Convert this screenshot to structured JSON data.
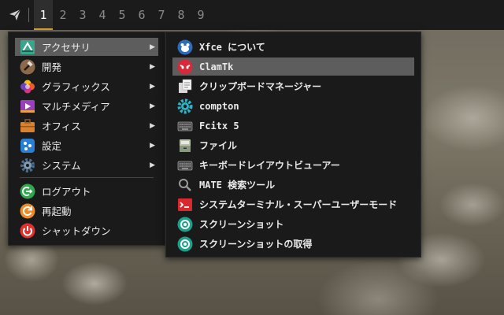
{
  "panel": {
    "workspaces": [
      "1",
      "2",
      "3",
      "4",
      "5",
      "6",
      "7",
      "8",
      "9"
    ],
    "active_workspace": "1"
  },
  "main_menu": {
    "items": [
      {
        "label": "アクセサリ",
        "icon": "accessories-icon"
      },
      {
        "label": "開発",
        "icon": "hammer-icon"
      },
      {
        "label": "グラフィックス",
        "icon": "graphics-icon"
      },
      {
        "label": "マルチメディア",
        "icon": "multimedia-icon"
      },
      {
        "label": "オフィス",
        "icon": "office-briefcase-icon"
      },
      {
        "label": "設定",
        "icon": "settings-icon"
      },
      {
        "label": "システム",
        "icon": "gear-icon"
      }
    ],
    "actions": [
      {
        "label": "ログアウト",
        "icon": "logout-icon"
      },
      {
        "label": "再起動",
        "icon": "restart-icon"
      },
      {
        "label": "シャットダウン",
        "icon": "power-icon"
      }
    ]
  },
  "sub_menu": {
    "items": [
      {
        "label": "Xfce について",
        "icon": "xfce-mouse-icon"
      },
      {
        "label": "ClamTk",
        "icon": "clamtk-icon"
      },
      {
        "label": "クリップボードマネージャー",
        "icon": "clipboard-icon"
      },
      {
        "label": "compton",
        "icon": "compton-gear-icon"
      },
      {
        "label": "Fcitx 5",
        "icon": "keyboard-icon"
      },
      {
        "label": "ファイル",
        "icon": "file-cabinet-icon"
      },
      {
        "label": "キーボードレイアウトビューアー",
        "icon": "keyboard-layout-icon"
      },
      {
        "label": "MATE 検索ツール",
        "icon": "search-icon"
      },
      {
        "label": "システムターミナル・スーパーユーザーモード",
        "icon": "terminal-icon"
      },
      {
        "label": "スクリーンショット",
        "icon": "screenshot-icon"
      },
      {
        "label": "スクリーンショットの取得",
        "icon": "screenshot-capture-icon"
      }
    ]
  }
}
